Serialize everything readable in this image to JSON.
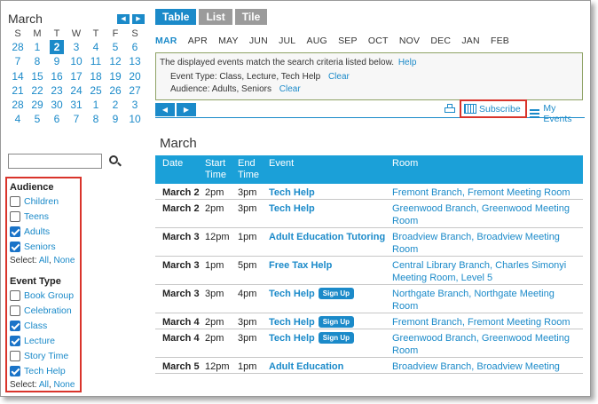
{
  "calendar": {
    "title": "March",
    "prev_label": "◀",
    "next_label": "▶",
    "weekdays": [
      "S",
      "M",
      "T",
      "W",
      "T",
      "F",
      "S"
    ],
    "weeks": [
      [
        "28",
        "1",
        "2",
        "3",
        "4",
        "5",
        "6"
      ],
      [
        "7",
        "8",
        "9",
        "10",
        "11",
        "12",
        "13"
      ],
      [
        "14",
        "15",
        "16",
        "17",
        "18",
        "19",
        "20"
      ],
      [
        "21",
        "22",
        "23",
        "24",
        "25",
        "26",
        "27"
      ],
      [
        "28",
        "29",
        "30",
        "31",
        "1",
        "2",
        "3"
      ],
      [
        "4",
        "5",
        "6",
        "7",
        "8",
        "9",
        "10"
      ]
    ],
    "today": "2"
  },
  "search": {
    "value": "",
    "placeholder": ""
  },
  "filters": {
    "audience": {
      "title": "Audience",
      "items": [
        {
          "label": "Children",
          "checked": false
        },
        {
          "label": "Teens",
          "checked": false
        },
        {
          "label": "Adults",
          "checked": true
        },
        {
          "label": "Seniors",
          "checked": true
        }
      ],
      "select_label": "Select:",
      "all_label": "All",
      "none_label": "None"
    },
    "event_type": {
      "title": "Event Type",
      "items": [
        {
          "label": "Book Group",
          "checked": false
        },
        {
          "label": "Celebration",
          "checked": false
        },
        {
          "label": "Class",
          "checked": true
        },
        {
          "label": "Lecture",
          "checked": true
        },
        {
          "label": "Story Time",
          "checked": false
        },
        {
          "label": "Tech Help",
          "checked": true
        }
      ],
      "select_label": "Select:",
      "all_label": "All",
      "none_label": "None"
    }
  },
  "tabs": [
    {
      "label": "Table",
      "active": true
    },
    {
      "label": "List",
      "active": false
    },
    {
      "label": "Tile",
      "active": false
    }
  ],
  "months": [
    {
      "label": "MAR",
      "active": true
    },
    {
      "label": "APR",
      "active": false
    },
    {
      "label": "MAY",
      "active": false
    },
    {
      "label": "JUN",
      "active": false
    },
    {
      "label": "JUL",
      "active": false
    },
    {
      "label": "AUG",
      "active": false
    },
    {
      "label": "SEP",
      "active": false
    },
    {
      "label": "OCT",
      "active": false
    },
    {
      "label": "NOV",
      "active": false
    },
    {
      "label": "DEC",
      "active": false
    },
    {
      "label": "JAN",
      "active": false
    },
    {
      "label": "FEB",
      "active": false
    }
  ],
  "criteria": {
    "intro": "The displayed events match the search criteria listed below.",
    "help_label": "Help",
    "event_type_line": "Event Type: Class, Lecture, Tech Help",
    "audience_line": "Audience: Adults, Seniors",
    "clear_label": "Clear"
  },
  "toolbar": {
    "prev_label": "◀",
    "next_label": "▶",
    "subscribe_label": "Subscribe",
    "my_events_label": "My Events"
  },
  "listing": {
    "month_heading": "March",
    "columns": {
      "date": "Date",
      "start": "Start Time",
      "end": "End Time",
      "event": "Event",
      "room": "Room"
    },
    "signup_label": "Sign Up",
    "rows": [
      {
        "date": "March 2",
        "start": "2pm",
        "end": "3pm",
        "event": "Tech Help",
        "signup": false,
        "room": "Fremont Branch, Fremont Meeting Room"
      },
      {
        "date": "March 2",
        "start": "2pm",
        "end": "3pm",
        "event": "Tech Help",
        "signup": false,
        "room": "Greenwood Branch, Greenwood Meeting Room"
      },
      {
        "date": "March 3",
        "start": "12pm",
        "end": "1pm",
        "event": "Adult Education Tutoring",
        "signup": false,
        "room": "Broadview Branch, Broadview Meeting Room"
      },
      {
        "date": "March 3",
        "start": "1pm",
        "end": "5pm",
        "event": "Free Tax Help",
        "signup": false,
        "room": "Central Library Branch, Charles Simonyi Meeting Room, Level 5"
      },
      {
        "date": "March 3",
        "start": "3pm",
        "end": "4pm",
        "event": "Tech Help",
        "signup": true,
        "room": "Northgate Branch, Northgate Meeting Room"
      },
      {
        "date": "March 4",
        "start": "2pm",
        "end": "3pm",
        "event": "Tech Help",
        "signup": true,
        "room": "Fremont Branch, Fremont Meeting Room"
      },
      {
        "date": "March 4",
        "start": "2pm",
        "end": "3pm",
        "event": "Tech Help",
        "signup": true,
        "room": "Greenwood Branch, Greenwood Meeting Room"
      },
      {
        "date": "March 5",
        "start": "12pm",
        "end": "1pm",
        "event": "Adult Education",
        "signup": false,
        "room": "Broadview Branch, Broadview Meeting"
      }
    ]
  }
}
